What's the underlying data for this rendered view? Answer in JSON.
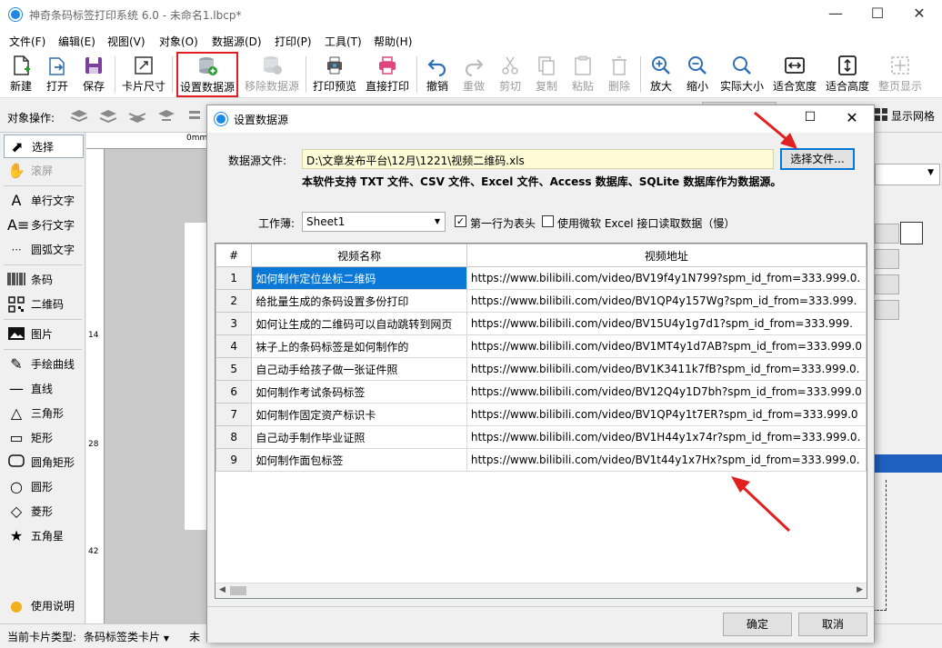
{
  "app": {
    "title": "神奇条码标签打印系统 6.0 - 未命名1.lbcp*"
  },
  "menu": [
    "文件(F)",
    "编辑(E)",
    "视图(V)",
    "对象(O)",
    "数据源(D)",
    "打印(P)",
    "工具(T)",
    "帮助(H)"
  ],
  "toolbar": {
    "new": "新建",
    "open": "打开",
    "save": "保存",
    "card_size": "卡片尺寸",
    "set_datasource": "设置数据源",
    "remove_datasource": "移除数据源",
    "print_preview": "打印预览",
    "direct_print": "直接打印",
    "undo": "撤销",
    "redo": "重做",
    "cut": "剪切",
    "copy": "复制",
    "paste": "粘贴",
    "delete": "删除",
    "zoom_in": "放大",
    "zoom_out": "缩小",
    "actual_size": "实际大小",
    "fit_width": "适合宽度",
    "fit_height": "适合高度",
    "full_page": "整页显示"
  },
  "objbar": {
    "label": "对象操作:",
    "show_grid": "显示网格"
  },
  "left_panel": {
    "items": [
      "选择",
      "滚屏",
      "单行文字",
      "多行文字",
      "圆弧文字",
      "条码",
      "二维码",
      "图片",
      "手绘曲线",
      "直线",
      "三角形",
      "矩形",
      "圆角矩形",
      "圆形",
      "菱形",
      "五角星"
    ],
    "help": "使用说明"
  },
  "ruler": {
    "top": "0mm",
    "marks": [
      "14",
      "28",
      "42"
    ]
  },
  "statusbar": {
    "card_type_label": "当前卡片类型:",
    "card_type_value": "条码标签类卡片",
    "tail": "未"
  },
  "dialog": {
    "title": "设置数据源",
    "file_label": "数据源文件:",
    "file_path": "D:\\文章发布平台\\12月\\1221\\视频二维码.xls",
    "choose_button": "选择文件...",
    "support_text": "本软件支持 TXT 文件、CSV 文件、Excel 文件、Access 数据库、SQLite 数据库作为数据源。",
    "sheet_label": "工作薄:",
    "sheet_value": "Sheet1",
    "first_row_header": "第一行为表头",
    "first_row_checked": true,
    "use_ms_excel": "使用微软 Excel 接口读取数据（慢）",
    "use_ms_checked": false,
    "table": {
      "headers": [
        "#",
        "视频名称",
        "视频地址"
      ],
      "rows": [
        [
          "1",
          "如何制作定位坐标二维码",
          "https://www.bilibili.com/video/BV19f4y1N799?spm_id_from=333.999.0."
        ],
        [
          "2",
          "给批量生成的条码设置多份打印",
          "https://www.bilibili.com/video/BV1QP4y157Wg?spm_id_from=333.999."
        ],
        [
          "3",
          "如何让生成的二维码可以自动跳转到网页",
          "https://www.bilibili.com/video/BV15U4y1g7d1?spm_id_from=333.999."
        ],
        [
          "4",
          "袜子上的条码标签是如何制作的",
          "https://www.bilibili.com/video/BV1MT4y1d7AB?spm_id_from=333.999.0"
        ],
        [
          "5",
          "自己动手给孩子做一张证件照",
          "https://www.bilibili.com/video/BV1K3411k7fB?spm_id_from=333.999.0."
        ],
        [
          "6",
          "如何制作考试条码标签",
          "https://www.bilibili.com/video/BV12Q4y1D7bh?spm_id_from=333.999.0"
        ],
        [
          "7",
          "如何制作固定资产标识卡",
          "https://www.bilibili.com/video/BV1QP4y1t7ER?spm_id_from=333.999.0"
        ],
        [
          "8",
          "自己动手制作毕业证照",
          "https://www.bilibili.com/video/BV1H44y1x74r?spm_id_from=333.999.0."
        ],
        [
          "9",
          "如何制作面包标签",
          "https://www.bilibili.com/video/BV1t44y1x7Hx?spm_id_from=333.999.0."
        ]
      ]
    },
    "ok": "确定",
    "cancel": "取消"
  },
  "colors": {
    "accent": "#0a78d7",
    "highlight_box": "#e02020",
    "annotation_arrow": "#e32020"
  }
}
